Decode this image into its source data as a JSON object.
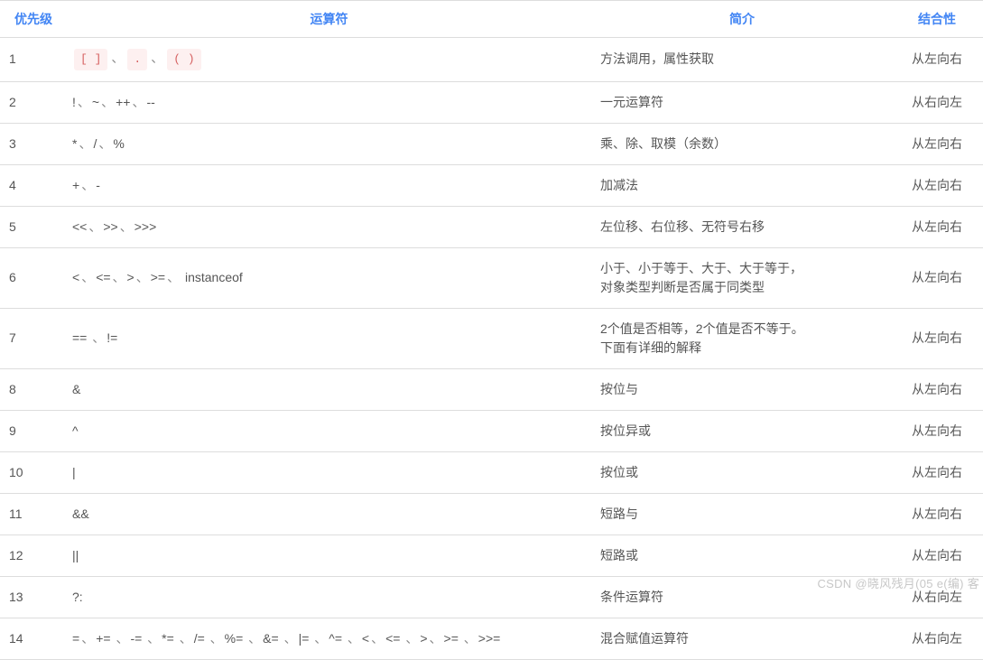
{
  "headers": {
    "priority": "优先级",
    "operator": "运算符",
    "desc": "简介",
    "assoc": "结合性"
  },
  "sep": "、",
  "rows": [
    {
      "priority": "1",
      "operators": [
        "[ ]",
        ".",
        "( )"
      ],
      "codeStyle": true,
      "desc": "方法调用，属性获取",
      "assoc": "从左向右"
    },
    {
      "priority": "2",
      "operators": [
        "!",
        "~",
        "++",
        "--"
      ],
      "codeStyle": false,
      "desc": "一元运算符",
      "assoc": "从右向左"
    },
    {
      "priority": "3",
      "operators": [
        "*",
        "/",
        "%"
      ],
      "codeStyle": false,
      "desc": "乘、除、取模（余数）",
      "assoc": "从左向右"
    },
    {
      "priority": "4",
      "operators": [
        "+",
        "-"
      ],
      "codeStyle": false,
      "desc": "加减法",
      "assoc": "从左向右"
    },
    {
      "priority": "5",
      "operators": [
        "<<",
        ">>",
        ">>>"
      ],
      "codeStyle": false,
      "desc": "左位移、右位移、无符号右移",
      "assoc": "从左向右"
    },
    {
      "priority": "6",
      "operators": [
        "<",
        "<=",
        ">",
        ">=",
        " instanceof"
      ],
      "codeStyle": false,
      "desc": "小于、小于等于、大于、大于等于，\n对象类型判断是否属于同类型",
      "assoc": "从左向右"
    },
    {
      "priority": "7",
      "operators": [
        "== ",
        "!="
      ],
      "codeStyle": false,
      "desc": "2个值是否相等，2个值是否不等于。\n下面有详细的解释",
      "assoc": "从左向右"
    },
    {
      "priority": "8",
      "operators": [
        "&"
      ],
      "codeStyle": false,
      "desc": "按位与",
      "assoc": "从左向右"
    },
    {
      "priority": "9",
      "operators": [
        "^"
      ],
      "codeStyle": false,
      "desc": "按位异或",
      "assoc": "从左向右"
    },
    {
      "priority": "10",
      "operators": [
        "|"
      ],
      "codeStyle": false,
      "desc": "按位或",
      "assoc": "从左向右"
    },
    {
      "priority": "11",
      "operators": [
        "&&"
      ],
      "codeStyle": false,
      "desc": "短路与",
      "assoc": "从左向右"
    },
    {
      "priority": "12",
      "operators": [
        "||"
      ],
      "codeStyle": false,
      "desc": "短路或",
      "assoc": "从左向右"
    },
    {
      "priority": "13",
      "operators": [
        "?:"
      ],
      "codeStyle": false,
      "desc": "条件运算符",
      "assoc": "从右向左"
    },
    {
      "priority": "14",
      "operators": [
        "=",
        "+= ",
        "-= ",
        "*= ",
        "/= ",
        "%= ",
        "&= ",
        "|= ",
        "^= ",
        "<",
        "<= ",
        ">",
        ">= ",
        ">>="
      ],
      "codeStyle": false,
      "desc": "混合赋值运算符",
      "assoc": "从右向左"
    }
  ],
  "watermark": "CSDN @晓风残月(05 e(编) 客"
}
